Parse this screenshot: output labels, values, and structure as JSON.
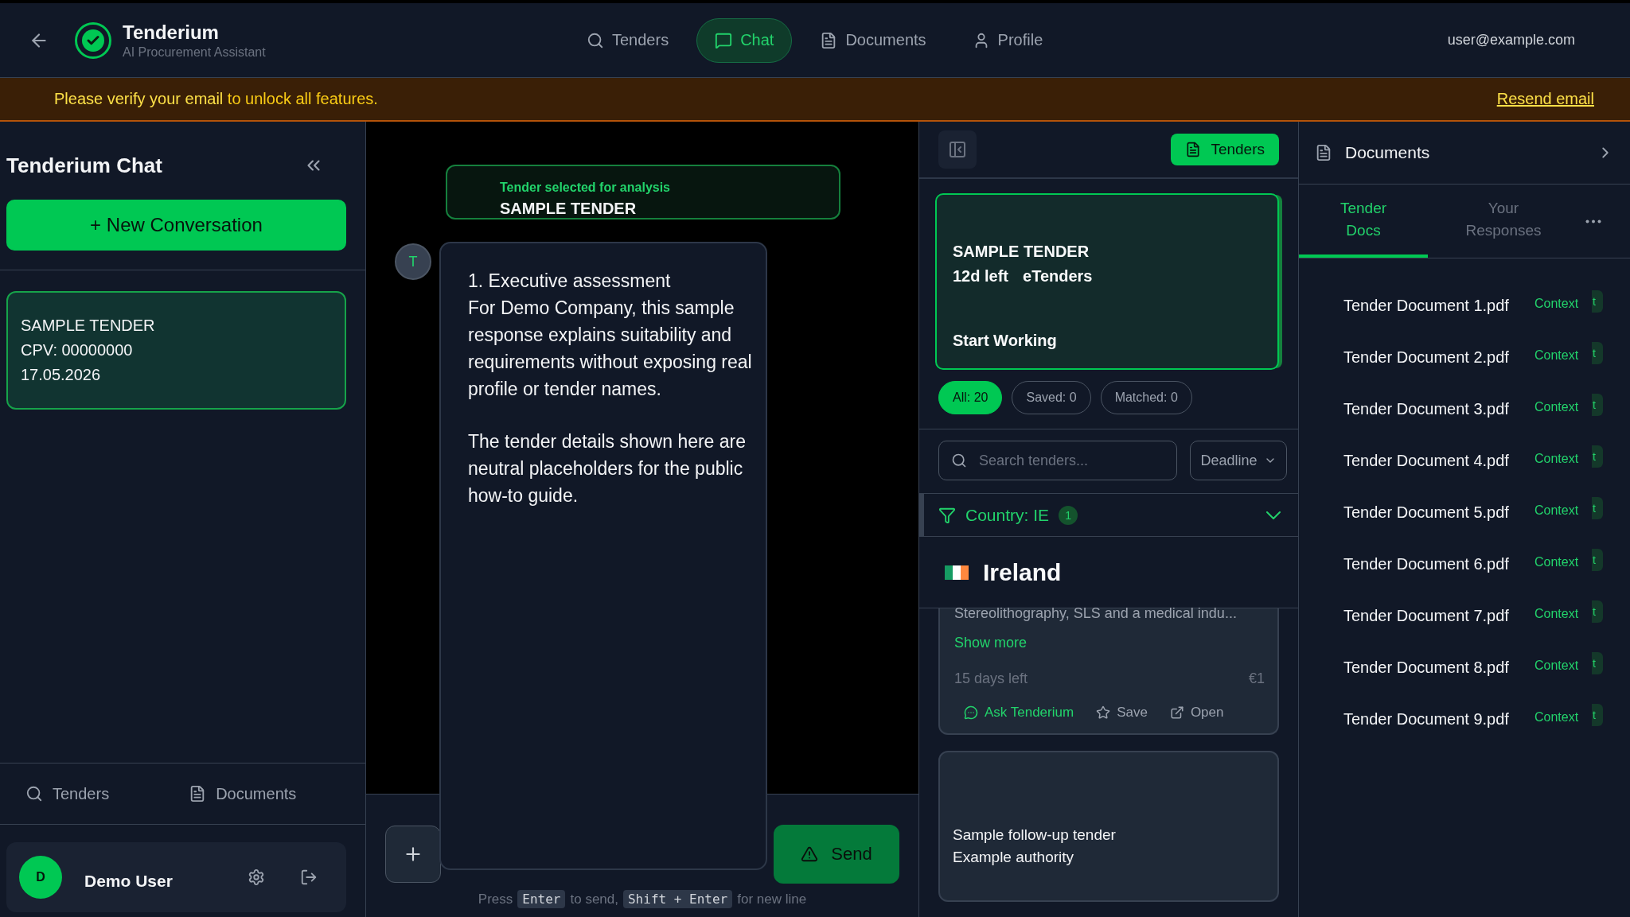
{
  "header": {
    "app_name": "Tenderium",
    "app_subtitle": "AI Procurement Assistant",
    "nav": [
      {
        "label": "Tenders",
        "selected": false
      },
      {
        "label": "Chat",
        "selected": true
      },
      {
        "label": "Documents",
        "selected": false
      },
      {
        "label": "Profile",
        "selected": false
      }
    ],
    "user_email": "user@example.com"
  },
  "banner": {
    "message": "Please verify your email",
    "message_rest": " to unlock all features.",
    "link": "Resend email"
  },
  "sidebar": {
    "title": "Tenderium Chat",
    "new_button": "+ New Conversation",
    "conversations": [
      {
        "lines": [
          "SAMPLE TENDER",
          "CPV: 00000000",
          "17.05.2026"
        ],
        "selected": true
      }
    ],
    "bottom_nav": [
      {
        "label": "Tenders"
      },
      {
        "label": "Documents"
      }
    ],
    "user": {
      "initial": "D",
      "name": "Demo User"
    }
  },
  "chat": {
    "selected_tender": {
      "caption": "Tender selected for analysis",
      "title": "SAMPLE TENDER"
    },
    "messages": [
      {
        "avatar": "T",
        "paragraphs": [
          "1. Executive assessment\nFor Demo Company, this sample response explains suitability and requirements without exposing real profile or tender names.",
          "The tender details shown here are neutral placeholders for the public how-to guide."
        ]
      }
    ],
    "send_button": "Send",
    "hint": [
      {
        "kind": "text",
        "text": "Press"
      },
      {
        "kind": "key",
        "text": "Enter"
      },
      {
        "kind": "text",
        "text": "to send,"
      },
      {
        "kind": "key",
        "text": "Shift + Enter"
      },
      {
        "kind": "text",
        "text": "for new line"
      }
    ]
  },
  "tenders_panel": {
    "tenders_button": "Tenders",
    "featured": {
      "title": "SAMPLE TENDER",
      "days_left": "12d left",
      "source": "eTenders",
      "action": "Start Working"
    },
    "filters": [
      {
        "label": "All: 20",
        "selected": true
      },
      {
        "label": "Saved: 0",
        "selected": false
      },
      {
        "label": "Matched: 0",
        "selected": false
      }
    ],
    "search": {
      "placeholder": "Search tenders..."
    },
    "sort": "Deadline",
    "country_filter": {
      "label": "Country: IE",
      "count": "1",
      "expanded": true
    },
    "group": {
      "name": "Ireland"
    },
    "cards": [
      {
        "kind": "detail",
        "description": "Stereolithography, SLS and a medical indu...",
        "show_more": "Show more",
        "days_left": "15 days left",
        "value": "€1",
        "actions": [
          "Ask Tenderium",
          "Save",
          "Open"
        ]
      },
      {
        "kind": "simple",
        "title": "Sample follow-up tender",
        "authority": "Example authority"
      }
    ]
  },
  "documents_panel": {
    "title": "Documents",
    "tabs": [
      {
        "label": "Tender Docs",
        "selected": true
      },
      {
        "label": "Your Responses",
        "selected": false
      }
    ],
    "documents": [
      {
        "name": "Tender Document 1.pdf",
        "tag": "Context",
        "cut_button": "t"
      },
      {
        "name": "Tender Document 2.pdf",
        "tag": "Context",
        "cut_button": "t"
      },
      {
        "name": "Tender Document 3.pdf",
        "tag": "Context",
        "cut_button": "t"
      },
      {
        "name": "Tender Document 4.pdf",
        "tag": "Context",
        "cut_button": "t"
      },
      {
        "name": "Tender Document 5.pdf",
        "tag": "Context",
        "cut_button": "t"
      },
      {
        "name": "Tender Document 6.pdf",
        "tag": "Context",
        "cut_button": "t"
      },
      {
        "name": "Tender Document 7.pdf",
        "tag": "Context",
        "cut_button": "t"
      },
      {
        "name": "Tender Document 8.pdf",
        "tag": "Context",
        "cut_button": "t"
      },
      {
        "name": "Tender Document 9.pdf",
        "tag": "Context",
        "cut_button": "t"
      }
    ]
  }
}
